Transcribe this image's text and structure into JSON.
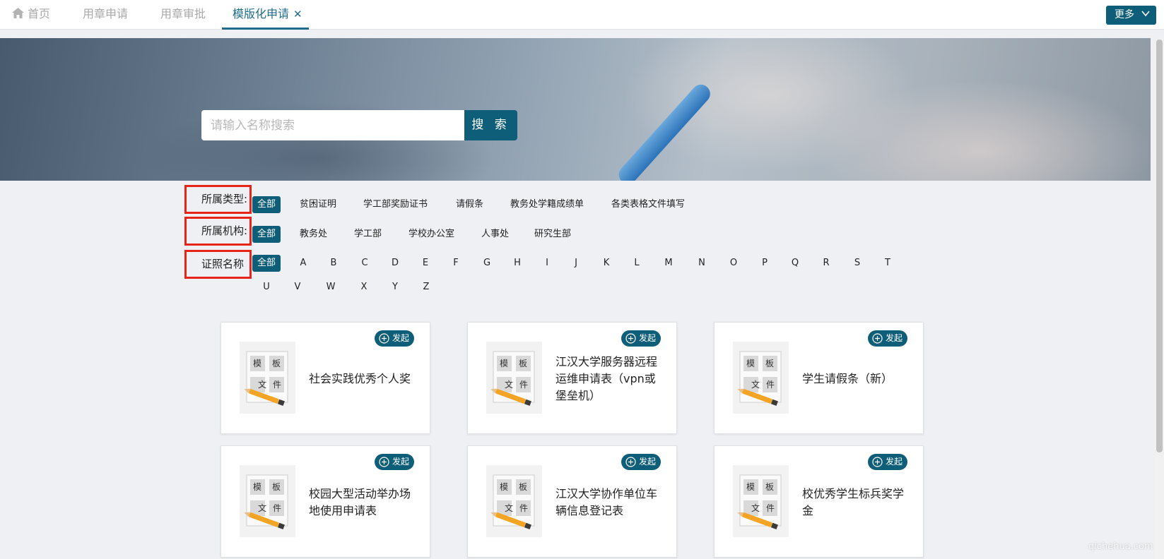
{
  "tabs": [
    {
      "label": "首页"
    },
    {
      "label": "用章申请"
    },
    {
      "label": "用章审批"
    },
    {
      "label": "模版化申请"
    }
  ],
  "more_label": "更多",
  "search": {
    "placeholder": "请输入名称搜索",
    "button_label": "搜 索"
  },
  "filters": {
    "type": {
      "label": "所属类型:",
      "options": [
        "全部",
        "贫困证明",
        "学工部奖励证书",
        "请假条",
        "教务处学籍成绩单",
        "各类表格文件填写"
      ]
    },
    "org": {
      "label": "所属机构:",
      "options": [
        "全部",
        "教务处",
        "学工部",
        "学校办公室",
        "人事处",
        "研究生部"
      ]
    },
    "cert": {
      "label": "证照名称",
      "all": "全部",
      "letters": [
        "A",
        "B",
        "C",
        "D",
        "E",
        "F",
        "G",
        "H",
        "I",
        "J",
        "K",
        "L",
        "M",
        "N",
        "O",
        "P",
        "Q",
        "R",
        "S",
        "T",
        "U",
        "V",
        "W",
        "X",
        "Y",
        "Z"
      ]
    }
  },
  "launch_label": "发起",
  "thumb_text": {
    "t1": "模",
    "t2": "板",
    "t3": "文",
    "t4": "件"
  },
  "cards": [
    {
      "title": "社会实践优秀个人奖"
    },
    {
      "title": "江汉大学服务器远程运维申请表（vpn或堡垒机）"
    },
    {
      "title": "学生请假条（新）"
    },
    {
      "title": "校园大型活动举办场地使用申请表"
    },
    {
      "title": "江汉大学协作单位车辆信息登记表"
    },
    {
      "title": "校优秀学生标兵奖学金"
    }
  ],
  "watermark": "qichehua.com",
  "colors": {
    "accent": "#0f5e79",
    "highlight_border": "#e8231a"
  }
}
